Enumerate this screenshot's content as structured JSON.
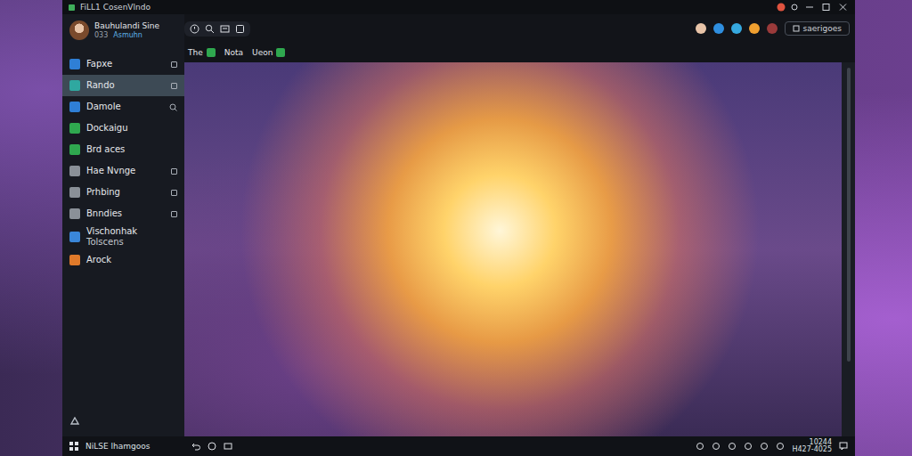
{
  "window": {
    "title": "FiLL1 CosenVlndo"
  },
  "profile": {
    "name": "Bauhulandi Sine",
    "id": "033",
    "status": "Asmuhn"
  },
  "sidebar": {
    "items": [
      {
        "label": "Fapxe",
        "selected": false,
        "kind": "action",
        "color": "#2f7fd6"
      },
      {
        "label": "Rando",
        "selected": true,
        "kind": "action",
        "color": "#2fa8a0"
      },
      {
        "label": "Damole",
        "selected": false,
        "kind": "search",
        "color": "#2f7fd6"
      },
      {
        "label": "Dockaigu",
        "selected": false,
        "kind": "plain",
        "color": "#2fa84f"
      },
      {
        "label": "Brd aces",
        "selected": false,
        "kind": "plain",
        "color": "#2fa84f"
      },
      {
        "label": "Hae Nvnge",
        "selected": false,
        "kind": "action",
        "color": "#8a9098"
      },
      {
        "label": "Prhbing",
        "selected": false,
        "kind": "action",
        "color": "#8a9098"
      },
      {
        "label": "Bnndies",
        "selected": false,
        "kind": "action",
        "color": "#8a9098"
      },
      {
        "label": "Vischonhak",
        "sub": "Tolscens",
        "selected": false,
        "kind": "plain",
        "color": "#3a86d8"
      },
      {
        "label": "Arock",
        "selected": false,
        "kind": "plain",
        "color": "#e07a2a"
      }
    ]
  },
  "footer": {
    "label": "NiLSE lhamgoos"
  },
  "toolbar": {
    "action": "saerigoes"
  },
  "tabs": [
    {
      "label": "The",
      "selected": false,
      "kind": "icon"
    },
    {
      "label": "Nota",
      "selected": false,
      "kind": "plain"
    },
    {
      "label": "Ueon",
      "selected": false,
      "kind": "icon"
    }
  ],
  "clock": {
    "time": "10244",
    "date": "H427-4025"
  }
}
